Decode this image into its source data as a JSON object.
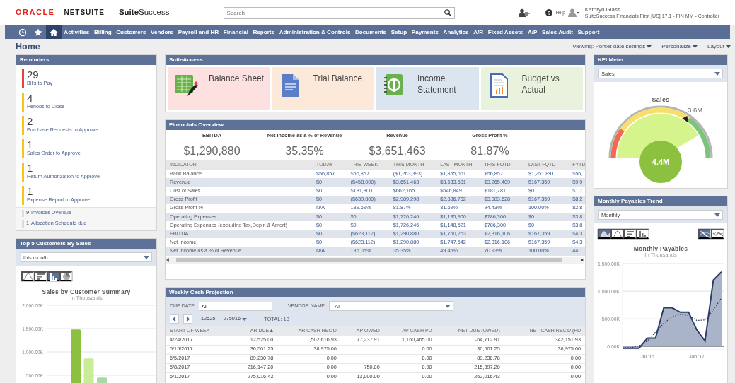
{
  "header": {
    "logo_brand": "ORACLE",
    "logo_product": "NETSUITE",
    "logo_edition": "**Suite**Success",
    "search": {
      "placeholder": "Search"
    },
    "help_icon": "?",
    "help_label": "Help",
    "user_name": "Kathryn Glass",
    "user_role": "SuiteSuccess Financials First [US] 17.1 - FIN MM - Controller"
  },
  "nav": [
    {
      "kind": "recent",
      "selected": false
    },
    {
      "kind": "favorites",
      "selected": false
    },
    {
      "kind": "home",
      "selected": true
    },
    {
      "kind": "menu",
      "label": "Activities",
      "selected": false
    },
    {
      "kind": "menu",
      "label": "Billing",
      "selected": false
    },
    {
      "kind": "menu",
      "label": "Customers",
      "selected": false
    },
    {
      "kind": "menu",
      "label": "Vendors",
      "selected": false
    },
    {
      "kind": "menu",
      "label": "Payroll and HR",
      "selected": false
    },
    {
      "kind": "menu",
      "label": "Financial",
      "selected": false
    },
    {
      "kind": "menu",
      "label": "Reports",
      "selected": false
    },
    {
      "kind": "menu",
      "label": "Administration & Controls",
      "selected": false
    },
    {
      "kind": "menu",
      "label": "Documents",
      "selected": false
    },
    {
      "kind": "menu",
      "label": "Setup",
      "selected": false
    },
    {
      "kind": "menu",
      "label": "Payments",
      "selected": false
    },
    {
      "kind": "menu",
      "label": "Analytics",
      "selected": false
    },
    {
      "kind": "menu",
      "label": "A/R",
      "selected": false
    },
    {
      "kind": "menu",
      "label": "Fixed Assets",
      "selected": false
    },
    {
      "kind": "menu",
      "label": "A/P",
      "selected": false
    },
    {
      "kind": "menu",
      "label": "Sales Audit",
      "selected": false
    },
    {
      "kind": "menu",
      "label": "Support",
      "selected": false
    }
  ],
  "page": {
    "title": "Home",
    "links": [
      "Viewing: Portlet date settings",
      "Personalize",
      "Layout"
    ]
  },
  "reminders": {
    "title": "Reminders",
    "items": [
      {
        "count": "29",
        "label": "Bills to Pay",
        "color": "#e8413c"
      },
      {
        "count": "4",
        "label": "Periods to Close",
        "color": "#f5c518"
      },
      {
        "count": "2",
        "label": "Purchase Requests to Approve",
        "color": "#f5c518"
      },
      {
        "count": "1",
        "label": "Sales Order to Approve",
        "color": "#f5c518"
      },
      {
        "count": "1",
        "label": "Return Authorization to Approve",
        "color": "#f5c518"
      },
      {
        "count": "1",
        "label": "Expense Report to Approve",
        "color": "#f5c518"
      }
    ],
    "minor_items": [
      {
        "count": "9",
        "label": "Invoices Overdue"
      },
      {
        "count": "1",
        "label": "Allocation Schedule due"
      }
    ]
  },
  "top_customers": {
    "title": "Top 5 Customers By Sales",
    "period": "this month",
    "chart_types": [
      {
        "kind": "line",
        "selected": false
      },
      {
        "kind": "hbar",
        "selected": false
      },
      {
        "kind": "column",
        "selected": true
      },
      {
        "kind": "pie",
        "selected": false
      }
    ],
    "chart_subtitle": "In Thousands",
    "chart_data": {
      "type": "bar",
      "title": "Sales by Customer Summary",
      "grid": true,
      "ylim": [
        0,
        2000
      ],
      "yticks": [
        {
          "value": 500,
          "label": "500.00K"
        },
        {
          "value": 1000,
          "label": "1,000.00K"
        },
        {
          "value": 1500,
          "label": "1,500.00K"
        },
        {
          "value": 2000,
          "label": "2,000.00K"
        }
      ],
      "series": [
        {
          "color": "#8cc13f",
          "values": [
            1480
          ]
        },
        {
          "color": "#c9ec98",
          "values": [
            860
          ]
        },
        {
          "color": "#a9d9a6",
          "values": [
            450
          ]
        }
      ]
    }
  },
  "suite_access": {
    "title": "SuiteAccess",
    "tiles": [
      {
        "label": "Balance Sheet",
        "color": "#fde1e1"
      },
      {
        "label": "Trial Balance",
        "color": "#fde9d9"
      },
      {
        "label": "Income Statement",
        "color": "#dbe5f0"
      },
      {
        "label": "Budget vs Actual",
        "color": "#e9f2dc"
      }
    ]
  },
  "financials": {
    "title": "Financials Overview",
    "kpis": [
      {
        "label": "EBITDA",
        "value": "$1,290,880"
      },
      {
        "label": "Net Income as a % of Revenue",
        "value": "35.35%"
      },
      {
        "label": "Revenue",
        "value": "$3,651,463"
      },
      {
        "label": "Gross Profit %",
        "value": "81.87%"
      }
    ],
    "table": {
      "columns": [
        "INDICATOR",
        "TODAY",
        "THIS WEEK",
        "THIS MONTH",
        "LAST MONTH",
        "THIS FQTD",
        "LAST FQTD",
        "FYTD"
      ],
      "rows": [
        [
          "Bank Balance",
          "$56,857",
          "$56,857",
          "($1,263,393)",
          "$1,355,661",
          "$56,857",
          "$1,251,891",
          "$56,"
        ],
        [
          "Revenue",
          "$0",
          "($458,000)",
          "$3,651,463",
          "$3,533,581",
          "$3,265,409",
          "$167,359",
          "$9,9"
        ],
        [
          "Cost of Sales",
          "$0",
          "$181,800",
          "$662,165",
          "$646,849",
          "$181,781",
          "$0",
          "$1,7"
        ],
        [
          "Gross Profit",
          "$0",
          "($639,800)",
          "$2,989,298",
          "$2,886,732",
          "$3,083,628",
          "$167,359",
          "$8,2"
        ],
        [
          "Gross Profit %",
          "N/A",
          "139.69%",
          "81.87%",
          "81.69%",
          "94.43%",
          "100.00%",
          "82.8"
        ],
        [
          "Operating Expenses",
          "$0",
          "$0",
          "$1,726,246",
          "$1,135,900",
          "$786,300",
          "$0",
          "$3,8"
        ],
        [
          "Operating Expenses (excluding Tax,Dep'n & Amort)",
          "$0",
          "$0",
          "$1,726,246",
          "$1,148,521",
          "$786,300",
          "$0",
          "$3,8"
        ],
        [
          "EBITDA",
          "$0",
          "($623,112)",
          "$1,290,880",
          "$1,760,263",
          "$2,316,106",
          "$167,359",
          "$4,3"
        ],
        [
          "Net Income",
          "$0",
          "($623,112)",
          "$1,290,880",
          "$1,747,642",
          "$2,316,106",
          "$167,359",
          "$4,3"
        ],
        [
          "Net Income as a % of Revenue",
          "N/A",
          "136.05%",
          "35.35%",
          "49.46%",
          "70.93%",
          "100.00%",
          "44.1"
        ]
      ]
    }
  },
  "cash_projection": {
    "title": "Weekly Cash Projection",
    "due_date": {
      "label": "DUE DATE",
      "value": "All"
    },
    "vendor": {
      "label": "VENDOR NAME",
      "value": "- All -"
    },
    "range": "12525 — 275016",
    "total_label": "TOTAL:",
    "total": "13",
    "columns": [
      {
        "label": "START OF WEEK",
        "sorted": false
      },
      {
        "label": "AR DUE",
        "sorted": true
      },
      {
        "label": "AR CASH REC'D",
        "sorted": false
      },
      {
        "label": "AP OWED",
        "sorted": false
      },
      {
        "label": "AP CASH PD",
        "sorted": false
      },
      {
        "label": "NET DUE (OWED)",
        "sorted": false
      },
      {
        "label": "NET CASH REC'D (PD",
        "sorted": false
      }
    ],
    "rows": [
      [
        "4/24/2017",
        "12,525.00",
        "1,502,616.93",
        "77,237.91",
        "1,160,465.00",
        "-64,712.91",
        "342,151.93"
      ],
      [
        "5/15/2017",
        "36,501.25",
        "38,975.00",
        null,
        "0.00",
        "36,501.25",
        "38,975.00"
      ],
      [
        "6/5/2017",
        "89,230.78",
        "0.00",
        null,
        "0.00",
        "89,230.78",
        "0.00"
      ],
      [
        "5/8/2017",
        "216,147.20",
        "0.00",
        "750.00",
        "0.00",
        "215,397.20",
        "0.00"
      ],
      [
        "5/1/2017",
        "275,016.43",
        "0.00",
        "13,000.00",
        "0.00",
        "262,016.43",
        "0.00"
      ]
    ]
  },
  "kpi_meter": {
    "title": "KPI Meter",
    "metric": "Sales",
    "gauge_title": "Sales",
    "target": "3.6M",
    "value": "4.4M"
  },
  "payables": {
    "title": "Monthly Payables Trend",
    "period": "Monthly",
    "chart_types": [
      {
        "kind": "area",
        "selected": true
      },
      {
        "kind": "line",
        "selected": false
      },
      {
        "kind": "hbar",
        "selected": false
      },
      {
        "kind": "column",
        "selected": false
      }
    ],
    "line_styles": [
      {
        "kind": "smooth",
        "selected": true
      },
      {
        "kind": "raw",
        "selected": false
      }
    ],
    "chart_subtitle": "In Thousands",
    "chart_data": {
      "type": "area",
      "title": "Monthly Payables",
      "grid": true,
      "categories": [
        null,
        null,
        null,
        "Jul '16",
        null,
        null,
        null,
        null,
        null,
        "Jan '17",
        null,
        null,
        null
      ],
      "ylim": [
        -60,
        1500
      ],
      "yticks": [
        {
          "value": 0,
          "label": "0.00K"
        },
        {
          "value": 500,
          "label": "500.00K"
        },
        {
          "value": 1000,
          "label": "1,000.00K"
        },
        {
          "value": 1500,
          "label": "1,500.00K"
        }
      ],
      "series": [
        {
          "color": "#2b3d66",
          "values": [
            -30,
            -30,
            -30,
            150,
            150,
            700,
            700,
            620,
            620,
            300,
            100,
            1200,
            1350
          ]
        },
        {
          "type": "line",
          "line_style": "dotted",
          "color": "#2b3d66",
          "values": [
            -20,
            -20,
            10,
            100,
            260,
            420,
            540,
            580,
            560,
            470,
            480,
            660,
            880
          ]
        }
      ]
    }
  }
}
